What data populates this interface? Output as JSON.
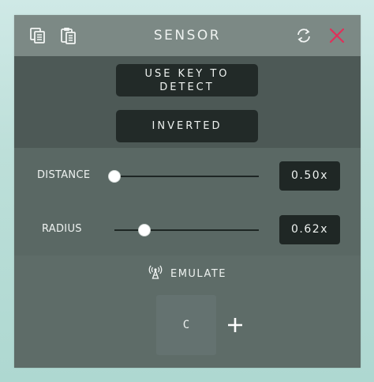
{
  "window": {
    "title": "SENSOR"
  },
  "header": {
    "icons": [
      "copy-icon",
      "paste-icon",
      "refresh-icon",
      "close-icon"
    ],
    "close_color": "#e0305a"
  },
  "buttons": {
    "use_key_line1": "USE KEY TO",
    "use_key_line2": "DETECT",
    "inverted": "INVERTED"
  },
  "sliders": {
    "distance": {
      "label": "DISTANCE",
      "value_text": "0.50x",
      "position": 0.0
    },
    "radius": {
      "label": "RADIUS",
      "value_text": "0.62x",
      "position": 0.21
    }
  },
  "emulate": {
    "label": "EMULATE",
    "icon": "antenna-icon",
    "key": "C",
    "add_icon": "plus-icon"
  }
}
